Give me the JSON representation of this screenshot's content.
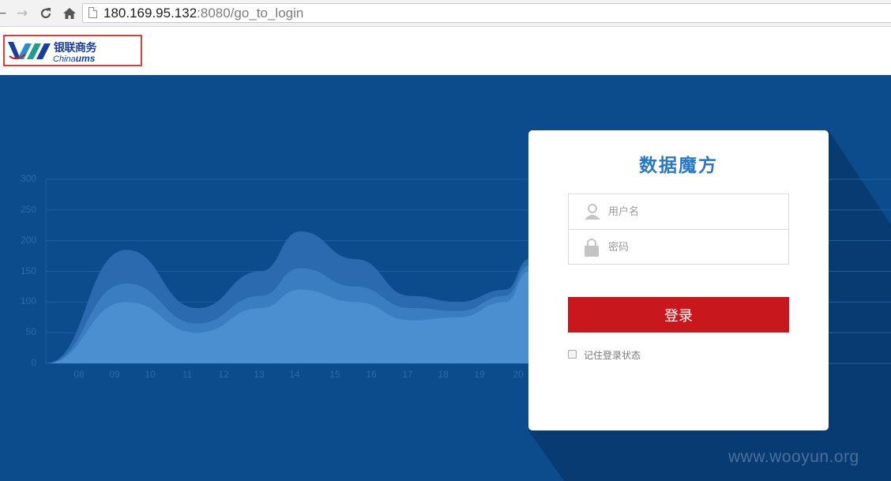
{
  "browser": {
    "url_host": "180.169.95.132",
    "url_rest": ":8080/go_to_login",
    "back_icon": "back-arrow-icon",
    "forward_icon": "forward-arrow-icon",
    "reload_icon": "reload-icon",
    "home_icon": "home-icon"
  },
  "header": {
    "logo_cn": "银联商务",
    "logo_en_prefix": "China",
    "logo_en_suffix": "ums",
    "logo_color": "#1b3f96",
    "highlight_color": "#e53935"
  },
  "background_chart": {
    "y_ticks": [
      "300",
      "250",
      "200",
      "150",
      "100",
      "50",
      "0"
    ],
    "x_ticks": [
      "08",
      "09",
      "10",
      "11",
      "12",
      "13",
      "14",
      "15",
      "16",
      "17",
      "18",
      "19",
      "20"
    ]
  },
  "chart_data": {
    "type": "area",
    "categories": [
      "08",
      "09",
      "10",
      "11",
      "12",
      "13",
      "14",
      "15",
      "16",
      "17",
      "18",
      "19",
      "20"
    ],
    "ylim": [
      0,
      300
    ],
    "series": [
      {
        "values": [
          0,
          185,
          90,
          150,
          215,
          170,
          110,
          100,
          120,
          170
        ]
      },
      {
        "values": [
          0,
          130,
          65,
          110,
          155,
          125,
          90,
          85,
          110,
          160
        ]
      },
      {
        "values": [
          0,
          100,
          50,
          90,
          120,
          100,
          70,
          75,
          100,
          150
        ]
      }
    ]
  },
  "login": {
    "title": "数据魔方",
    "username_placeholder": "用户名",
    "password_placeholder": "密码",
    "submit_label": "登录",
    "remember_label": "记住登录状态",
    "button_color": "#c8181d",
    "title_color": "#2a78c2"
  },
  "watermark": "www.wooyun.org"
}
